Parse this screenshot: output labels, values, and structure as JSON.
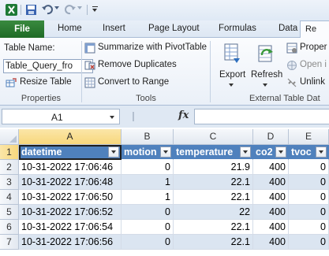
{
  "qat": {
    "app_icon": "excel-icon",
    "save_icon": "save-icon",
    "undo_icon": "undo-icon",
    "redo_icon": "redo-icon",
    "customize_icon": "customize-qat-icon"
  },
  "tabs": [
    {
      "label": "File",
      "active": false
    },
    {
      "label": "Home"
    },
    {
      "label": "Insert"
    },
    {
      "label": "Page Layout"
    },
    {
      "label": "Formulas"
    },
    {
      "label": "Data"
    },
    {
      "label": "Re"
    }
  ],
  "ribbon": {
    "properties": {
      "table_name_label": "Table Name:",
      "table_name_value": "Table_Query_fro",
      "resize_label": "Resize Table",
      "group_label": "Properties"
    },
    "tools": {
      "summarize_label": "Summarize with PivotTable",
      "remove_dupes_label": "Remove Duplicates",
      "convert_label": "Convert to Range",
      "group_label": "Tools"
    },
    "external": {
      "export_label": "Export",
      "refresh_label": "Refresh",
      "properties_label": "Proper",
      "open_label": "Open i",
      "unlink_label": "Unlink",
      "group_label": "External Table Dat"
    }
  },
  "formula_bar": {
    "name_box": "A1",
    "fx_label": "fx",
    "formula": ""
  },
  "grid": {
    "columns": [
      "A",
      "B",
      "C",
      "D",
      "E"
    ],
    "selected_column": "A",
    "selected_row": "1",
    "row_numbers": [
      "1",
      "2",
      "3",
      "4",
      "5",
      "6",
      "7"
    ],
    "headers": [
      "datetime",
      "motion",
      "temperature",
      "co2",
      "tvoc"
    ],
    "rows": [
      [
        "10-31-2022 17:06:46",
        "0",
        "21.9",
        "400",
        "0"
      ],
      [
        "10-31-2022 17:06:48",
        "1",
        "22.1",
        "400",
        "0"
      ],
      [
        "10-31-2022 17:06:50",
        "1",
        "22.1",
        "400",
        "0"
      ],
      [
        "10-31-2022 17:06:52",
        "0",
        "22",
        "400",
        "0"
      ],
      [
        "10-31-2022 17:06:54",
        "0",
        "22.1",
        "400",
        "0"
      ],
      [
        "10-31-2022 17:06:56",
        "0",
        "22.1",
        "400",
        "0"
      ]
    ]
  },
  "colors": {
    "header_fill": "#4f81bd",
    "band_fill": "#dbe5f1",
    "file_tab": "#2a7a30"
  }
}
